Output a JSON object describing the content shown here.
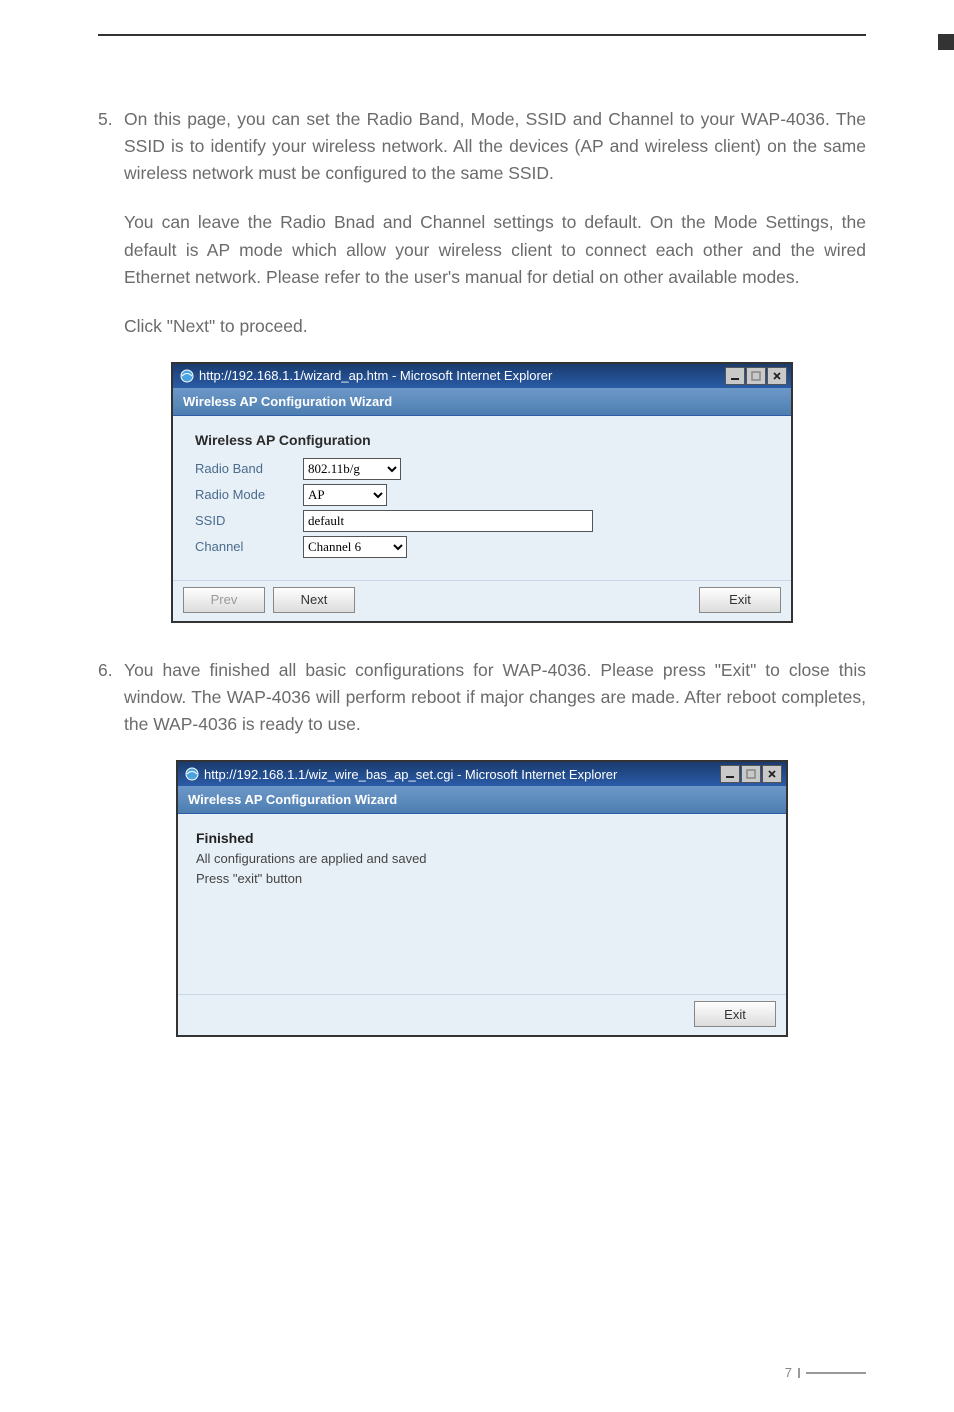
{
  "step5": {
    "num": "5.",
    "p1": "On this page, you can set the Radio Band, Mode, SSID and Channel to your WAP-4036. The SSID is to identify your wireless network. All the devices (AP and wireless client) on the same wireless network must be configured to the same SSID.",
    "p2": "You can leave the Radio Bnad and Channel settings to default. On the Mode Settings, the default is AP mode which allow your wireless client to connect each other and the wired Ethernet network. Please refer to the user's manual for detial on other available modes.",
    "p3": "Click \"Next\" to proceed."
  },
  "win1": {
    "title": "http://192.168.1.1/wizard_ap.htm - Microsoft Internet Explorer",
    "subheader": "Wireless AP Configuration Wizard",
    "section": "Wireless AP Configuration",
    "labels": {
      "radio_band": "Radio Band",
      "radio_mode": "Radio Mode",
      "ssid": "SSID",
      "channel": "Channel"
    },
    "values": {
      "radio_band": "802.11b/g",
      "radio_mode": "AP",
      "ssid": "default",
      "channel": "Channel 6"
    },
    "buttons": {
      "prev": "Prev",
      "next": "Next",
      "exit": "Exit"
    }
  },
  "step6": {
    "num": "6.",
    "p1": "You have finished all basic configurations for WAP-4036. Please press \"Exit\" to close this window. The WAP-4036 will perform reboot if major changes are made. After reboot completes, the WAP-4036 is ready to use."
  },
  "win2": {
    "title": "http://192.168.1.1/wiz_wire_bas_ap_set.cgi - Microsoft Internet Explorer",
    "subheader": "Wireless AP Configuration Wizard",
    "finished": "Finished",
    "line1": "All configurations are applied and saved",
    "line2": "Press \"exit\" button",
    "exit": "Exit"
  },
  "pagenum": "7"
}
